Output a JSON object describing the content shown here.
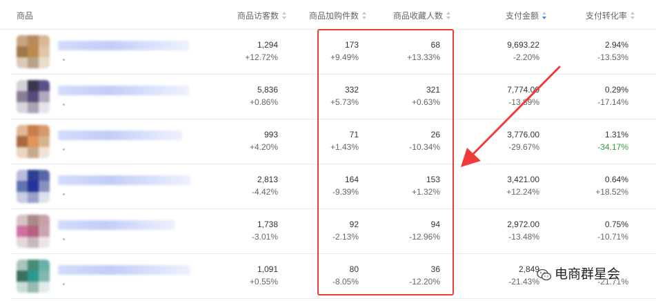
{
  "columns": {
    "product": "商品",
    "visitors": "商品访客数",
    "cart": "商品加购件数",
    "favorites": "商品收藏人数",
    "payment": "支付金额",
    "conversion": "支付转化率"
  },
  "rows": [
    {
      "visitors": "1,294",
      "visitors_change": "+12.72%",
      "cart": "173",
      "cart_change": "+9.49%",
      "fav": "68",
      "fav_change": "+13.33%",
      "pay": "9,693.22",
      "pay_change": "-2.20%",
      "conv": "2.94%",
      "conv_change": "-13.53%"
    },
    {
      "visitors": "5,836",
      "visitors_change": "+0.86%",
      "cart": "332",
      "cart_change": "+5.73%",
      "fav": "321",
      "fav_change": "+0.63%",
      "pay": "7,774.00",
      "pay_change": "-13.89%",
      "conv": "0.29%",
      "conv_change": "-17.14%"
    },
    {
      "visitors": "993",
      "visitors_change": "+4.20%",
      "cart": "71",
      "cart_change": "+1.43%",
      "fav": "26",
      "fav_change": "-10.34%",
      "pay": "3,776.00",
      "pay_change": "-29.67%",
      "conv": "1.31%",
      "conv_change": "-34.17%"
    },
    {
      "visitors": "2,813",
      "visitors_change": "-4.42%",
      "cart": "164",
      "cart_change": "-9.39%",
      "fav": "153",
      "fav_change": "+1.32%",
      "pay": "3,421.00",
      "pay_change": "+12.24%",
      "conv": "0.64%",
      "conv_change": "+18.52%"
    },
    {
      "visitors": "1,738",
      "visitors_change": "-3.01%",
      "cart": "92",
      "cart_change": "-2.13%",
      "fav": "94",
      "fav_change": "-12.96%",
      "pay": "2,972.00",
      "pay_change": "-13.48%",
      "conv": "0.75%",
      "conv_change": "-10.71%"
    },
    {
      "visitors": "1,091",
      "visitors_change": "+0.55%",
      "cart": "80",
      "cart_change": "-8.05%",
      "fav": "36",
      "fav_change": "-12.20%",
      "pay": "2,849",
      "pay_change": "-21.43%",
      "conv": "",
      "conv_change": "-21.71%"
    }
  ],
  "watermark": "电商群星会",
  "colors": {
    "highlight": "#f03a3a",
    "arrow": "#f03a3a",
    "sort_active": "#3a87f7",
    "negative_green": "#2a9d3a"
  }
}
